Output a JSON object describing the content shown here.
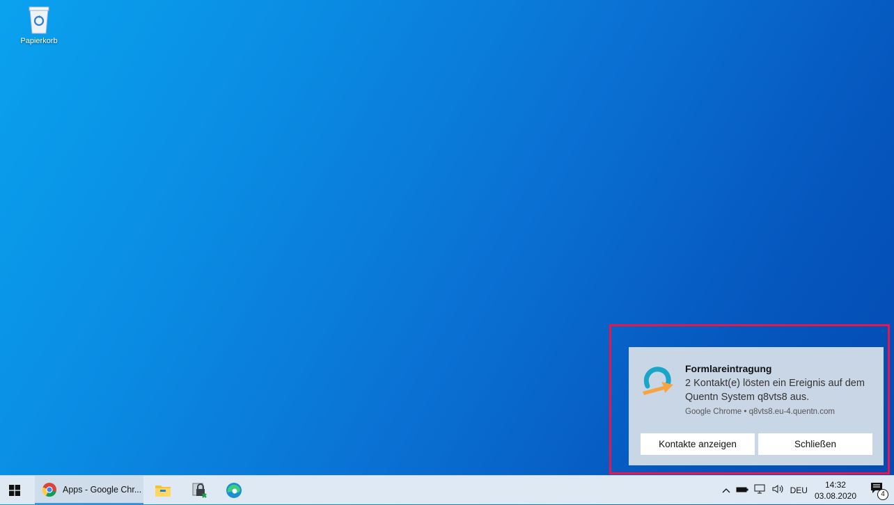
{
  "desktop": {
    "icons": [
      {
        "label": "Papierkorb",
        "icon": "recycle-bin-icon"
      }
    ]
  },
  "toast": {
    "title": "Formlareintragung",
    "body": "2 Kontakt(e) lösten ein Ereignis auf dem Quentn System q8vts8 aus.",
    "attribution": "Google Chrome • q8vts8.eu-4.quentn.com",
    "buttons": {
      "primary": "Kontakte anzeigen",
      "secondary": "Schließen"
    },
    "highlight_color": "#e8164b"
  },
  "taskbar": {
    "active_window_label": "Apps - Google Chr...",
    "tray": {
      "language": "DEU",
      "time": "14:32",
      "date": "03.08.2020",
      "notification_count": "4"
    }
  }
}
